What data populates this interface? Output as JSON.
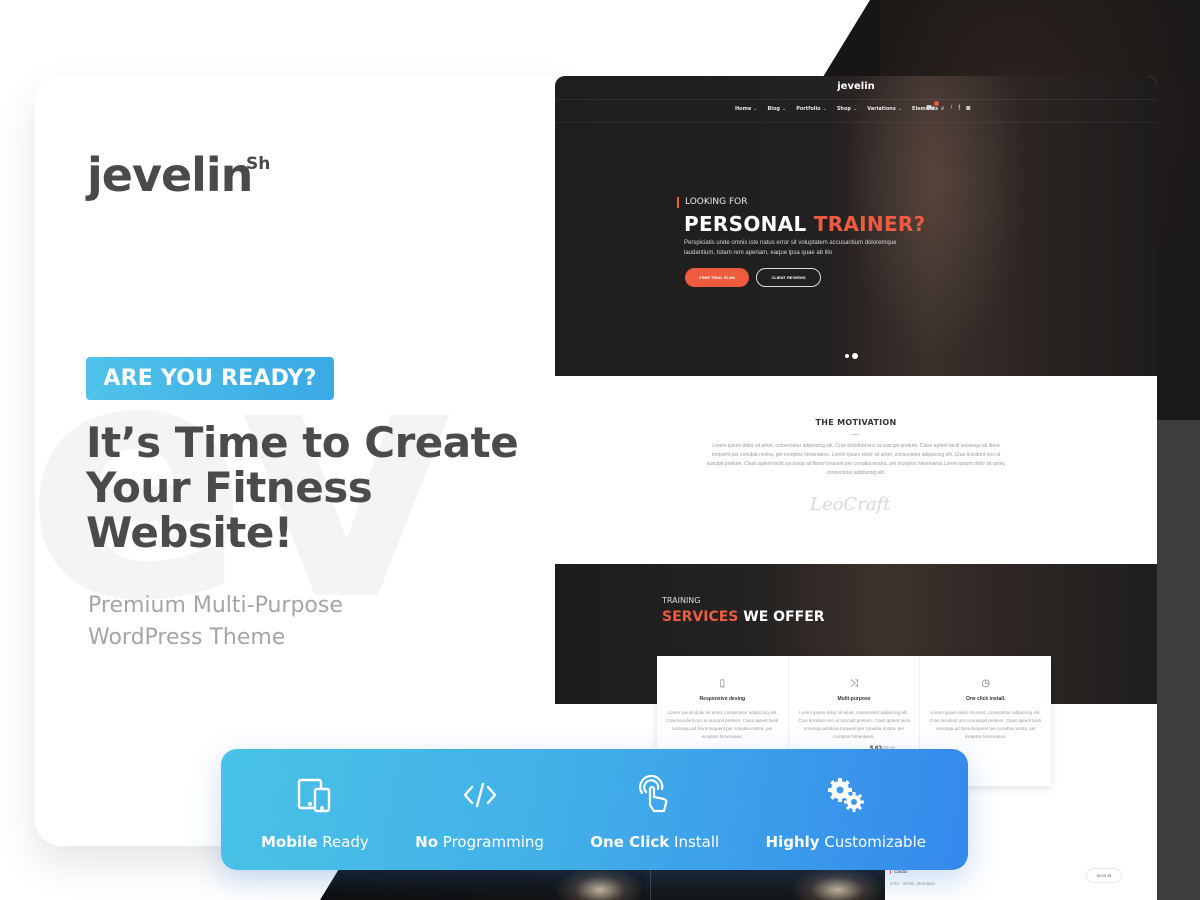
{
  "brand": {
    "logo": "jevelin",
    "logo_suffix": "Sh"
  },
  "left_panel": {
    "watermark": "ev",
    "badge": "ARE YOU READY?",
    "headline_lines": [
      "It’s Time to Create",
      "Your Fitness",
      "Website!"
    ],
    "subline_lines": [
      "Premium Multi-Purpose",
      "WordPress Theme"
    ]
  },
  "mockup": {
    "logo": "jevelin",
    "nav": [
      {
        "label": "Home"
      },
      {
        "label": "Blog"
      },
      {
        "label": "Portfolio"
      },
      {
        "label": "Shop"
      },
      {
        "label": "Variations"
      },
      {
        "label": "Elements"
      }
    ],
    "nav_icons": [
      "cart-icon",
      "search-icon",
      "twitter-icon",
      "facebook-icon",
      "instagram-icon"
    ],
    "hero": {
      "pre_title": "LOOKING FOR",
      "title_main": "PERSONAL",
      "title_accent": "TRAINER?",
      "text": "Perspiciatis unde omnis iste natus error sit voluptatem accusantium doloremque laudantium, totam rem aperiam, eaque ipsa quae ab illo",
      "primary_button": "FREE TRIAL PLAN",
      "secondary_button": "CLIENT REVIEWS",
      "slide_count": 2,
      "active_slide": 2
    },
    "motivation": {
      "title": "THE MOTIVATION",
      "text": "Lorem ipsum dolor sit amet, consectetur adipiscing elit. Cras tincidunt orci ut suscipit pretium. Class aptent taciti sociosqu ad litora torquent per conubia nostra, per inceptos himenaeos. Lorem ipsum dolor sit amet, consectetur adipiscing elit. Cras tincidunt orci ut suscipit pretium. Class aptent taciti sociosqu ad litora torquent per conubia nostra, per inceptos himenaeos.Lorem ipsum dolor sit amet, consectetur adipiscing elit.",
      "signature": "LeoCraft"
    },
    "services": {
      "pre_title": "TRAINING",
      "title_accent": "SERVICES",
      "title_main": "WE OFFER",
      "cards": [
        {
          "icon": "mobile-icon",
          "glyph": "▯",
          "name": "Responsive desing",
          "desc": "Lorem ipsum dolor sit amet, consectetur adipiscing elit. Cras tincidunt orci ut suscipit pretium. Class aptent taciti sociosqu ad litora torquent per conubia nostra, per inceptos himenaeos."
        },
        {
          "icon": "shuffle-icon",
          "glyph": "⤨",
          "name": "Multi-purpose",
          "desc": "Lorem ipsum dolor sit amet, consectetur adipiscing elit. Cras tincidunt orci ut suscipit pretium. Class aptent taciti sociosqu ad litora torquent per conubia nostra, per inceptos himenaeos."
        },
        {
          "icon": "stopwatch-icon",
          "glyph": "◷",
          "name": "One click install.",
          "desc": "Lorem ipsum dolor sit amet, consectetur adipiscing elit. Cras tincidunt orci ut suscipit pretium. Class aptent taciti sociosqu ad litora torquent per conubia nostra, per inceptos himenaeos."
        }
      ],
      "price": "$ 63",
      "price_unit": "/mon"
    },
    "class_schedule": {
      "name": "Cardio",
      "time": "8:00 - 09:00, Mondays",
      "button": "SIGN IN"
    }
  },
  "features": [
    {
      "icon": "devices-icon",
      "bold": "Mobile",
      "rest": "Ready"
    },
    {
      "icon": "code-icon",
      "bold": "No",
      "rest": "Programming"
    },
    {
      "icon": "tap-icon",
      "bold": "One Click",
      "rest": "Install"
    },
    {
      "icon": "gears-icon",
      "bold": "Highly",
      "rest": "Customizable"
    }
  ],
  "colors": {
    "accent_orange": "#ef5b3f",
    "badge_blue": "#3aa9e6",
    "feature_gradient_start": "#49c2e6",
    "feature_gradient_end": "#3489ec",
    "heading_gray": "#4b4b4b"
  }
}
